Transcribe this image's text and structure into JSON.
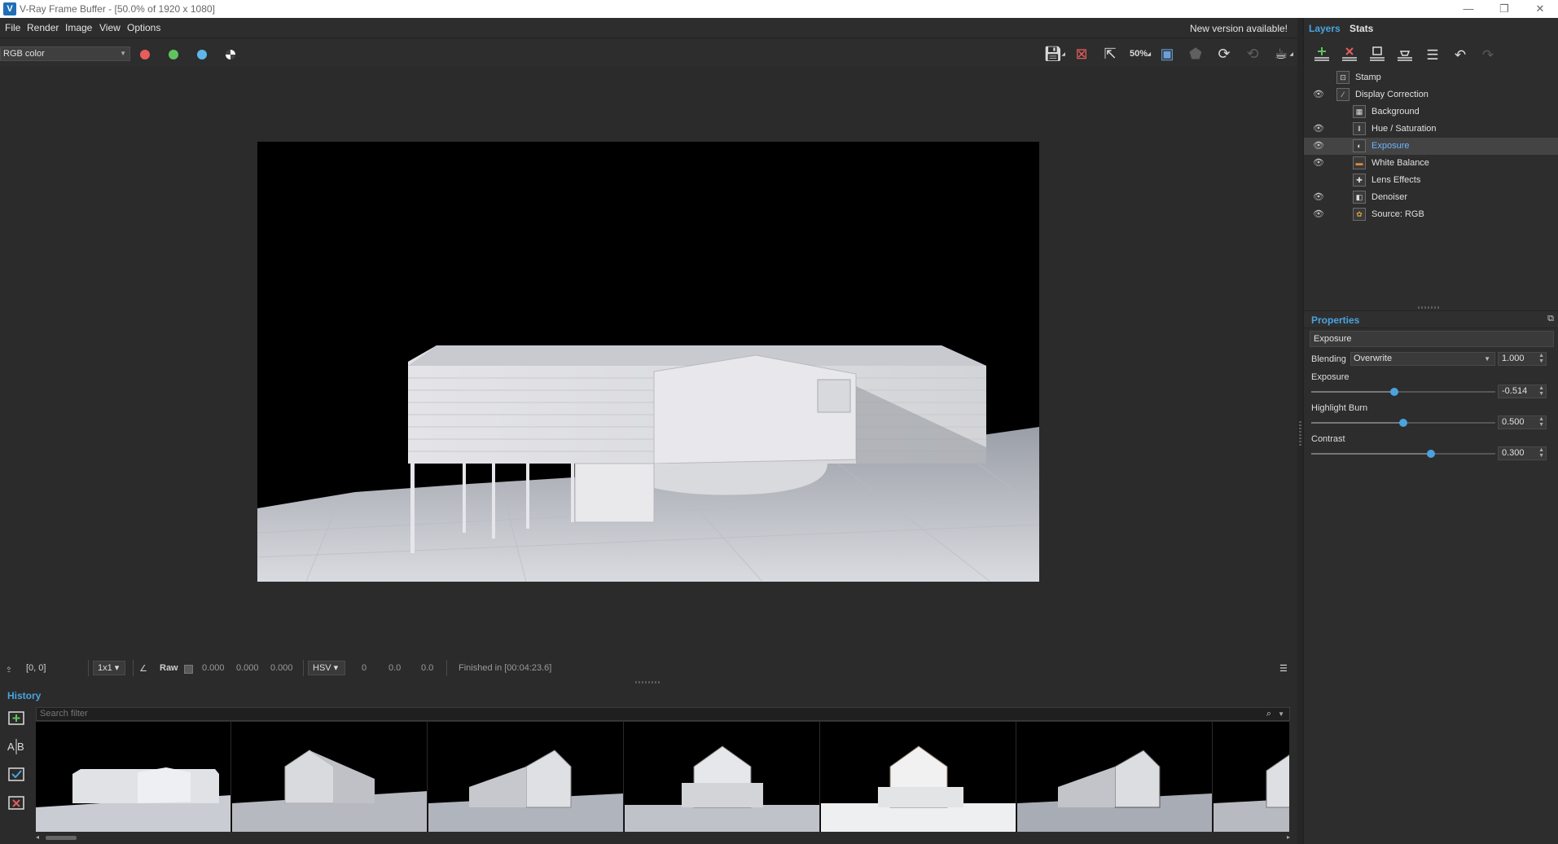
{
  "window": {
    "title": "V-Ray Frame Buffer - [50.0% of 1920 x 1080]",
    "app_icon": "vray-icon",
    "minimize": "—",
    "maximize": "❐",
    "close": "✕"
  },
  "menu": {
    "items": [
      "File",
      "Render",
      "Image",
      "View",
      "Options"
    ],
    "notice": "New version available!"
  },
  "toolbar": {
    "channel": "RGB color",
    "channel_dots": [
      {
        "name": "red-channel",
        "color": "#e85c5c"
      },
      {
        "name": "green-channel",
        "color": "#5fc45f"
      },
      {
        "name": "blue-channel",
        "color": "#5fb6ea"
      },
      {
        "name": "alpha-channel",
        "color": "#ffffff"
      }
    ],
    "zoom_label": "50%"
  },
  "status": {
    "coords": "[0, 0]",
    "sample_size": "1x1",
    "raw_label": "Raw",
    "rgb_values": [
      "0.000",
      "0.000",
      "0.000"
    ],
    "color_model": "HSV",
    "hsv_values": [
      "0",
      "0.0",
      "0.0"
    ],
    "render_status": "Finished in [00:04:23.6]"
  },
  "history": {
    "title": "History",
    "search_placeholder": "Search filter",
    "thumbnail_count": 7
  },
  "right_panel": {
    "tabs": [
      "Layers",
      "Stats"
    ],
    "layers": [
      {
        "label": "Stamp",
        "visible": false,
        "indent": 0,
        "icon": "stamp-icon",
        "glyph": "⊡"
      },
      {
        "label": "Display Correction",
        "visible": true,
        "indent": 0,
        "icon": "curve-icon",
        "glyph": "∕"
      },
      {
        "label": "Background",
        "visible": false,
        "indent": 1,
        "icon": "background-icon",
        "glyph": "▦"
      },
      {
        "label": "Hue / Saturation",
        "visible": true,
        "indent": 1,
        "icon": "hue-saturation-icon",
        "glyph": "‖"
      },
      {
        "label": "Exposure",
        "visible": true,
        "indent": 1,
        "icon": "exposure-icon",
        "glyph": "◐",
        "selected": true
      },
      {
        "label": "White Balance",
        "visible": true,
        "indent": 1,
        "icon": "white-balance-icon",
        "glyph": "▬"
      },
      {
        "label": "Lens Effects",
        "visible": false,
        "indent": 1,
        "icon": "lens-effects-icon",
        "glyph": "✚"
      },
      {
        "label": "Denoiser",
        "visible": true,
        "indent": 1,
        "icon": "denoiser-icon",
        "glyph": "◧"
      },
      {
        "label": "Source: RGB",
        "visible": true,
        "indent": 1,
        "icon": "source-rgb-icon",
        "glyph": "✿"
      }
    ],
    "properties": {
      "title": "Properties",
      "layer_name": "Exposure",
      "blending_label": "Blending",
      "blending_mode": "Overwrite",
      "blending_amount": "1.000",
      "exposure_label": "Exposure",
      "exposure_value": "-0.514",
      "exposure_fraction": 0.45,
      "highlight_burn_label": "Highlight Burn",
      "highlight_burn_value": "0.500",
      "highlight_burn_fraction": 0.5,
      "contrast_label": "Contrast",
      "contrast_value": "0.300",
      "contrast_fraction": 0.65
    }
  },
  "colors": {
    "accent": "#4aa3df",
    "background": "#2b2b2b",
    "panel": "#2d2d2d"
  }
}
